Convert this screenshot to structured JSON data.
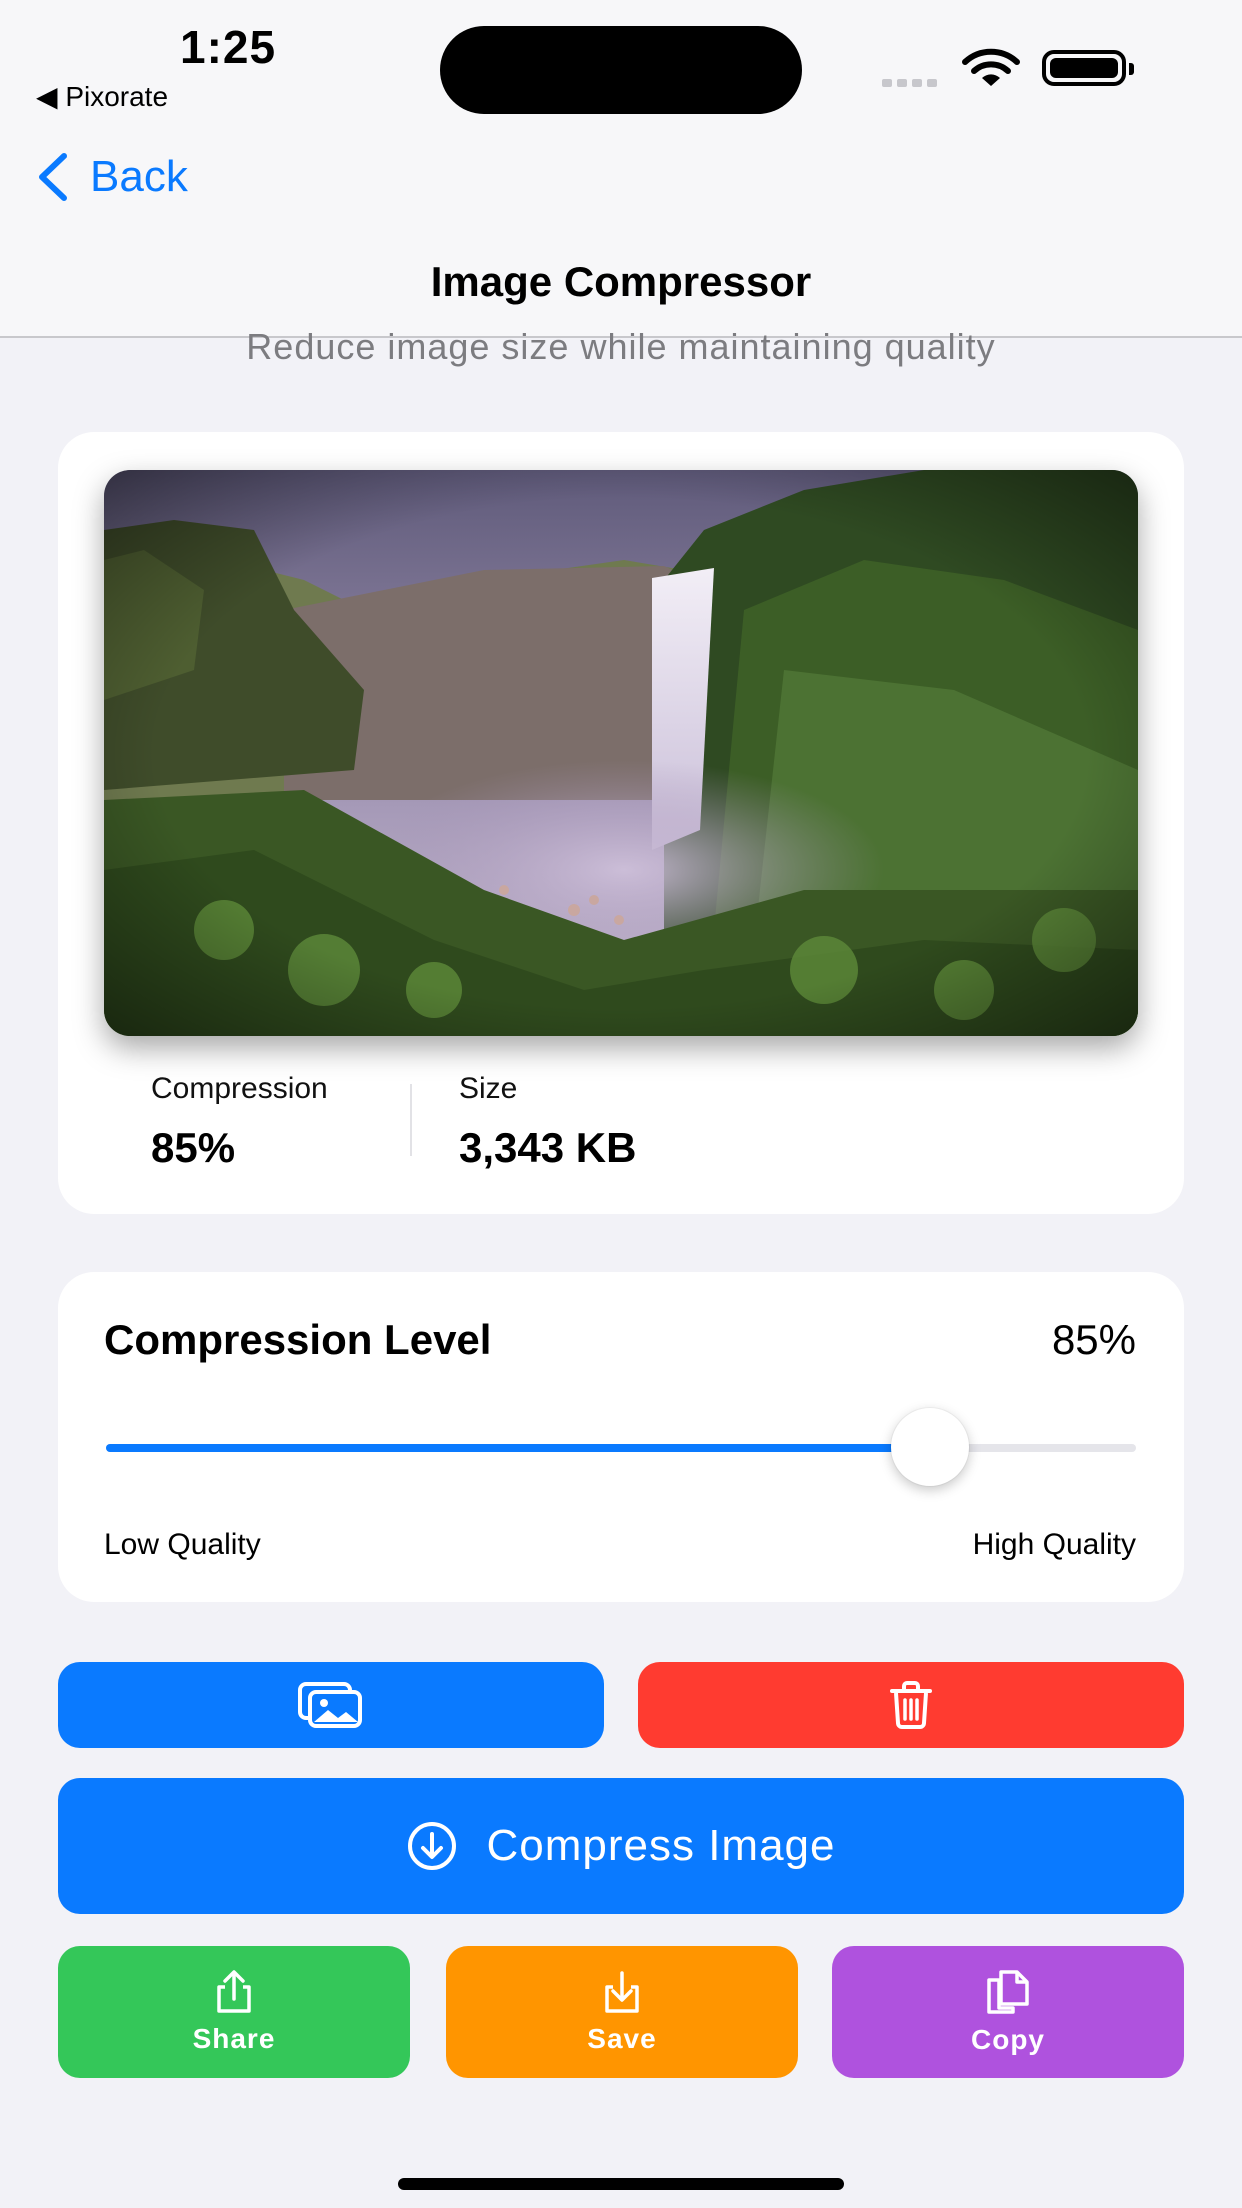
{
  "status_bar": {
    "time": "1:25",
    "back_app": "◀ Pixorate"
  },
  "nav": {
    "back_label": "Back",
    "title": "Image Compressor"
  },
  "subtitle": "Reduce image size while maintaining quality",
  "preview": {
    "compression_label": "Compression",
    "compression_value": "85%",
    "size_label": "Size",
    "size_value": "3,343 KB"
  },
  "slider": {
    "title": "Compression Level",
    "value_text": "85%",
    "level": 0.8,
    "low_label": "Low Quality",
    "high_label": "High Quality"
  },
  "actions": {
    "compress_label": "Compress Image",
    "share_label": "Share",
    "save_label": "Save",
    "copy_label": "Copy"
  },
  "colors": {
    "accent": "#0a7aff",
    "danger": "#ff3b30",
    "share": "#34c759",
    "save": "#ff9500",
    "copy": "#af52de"
  }
}
